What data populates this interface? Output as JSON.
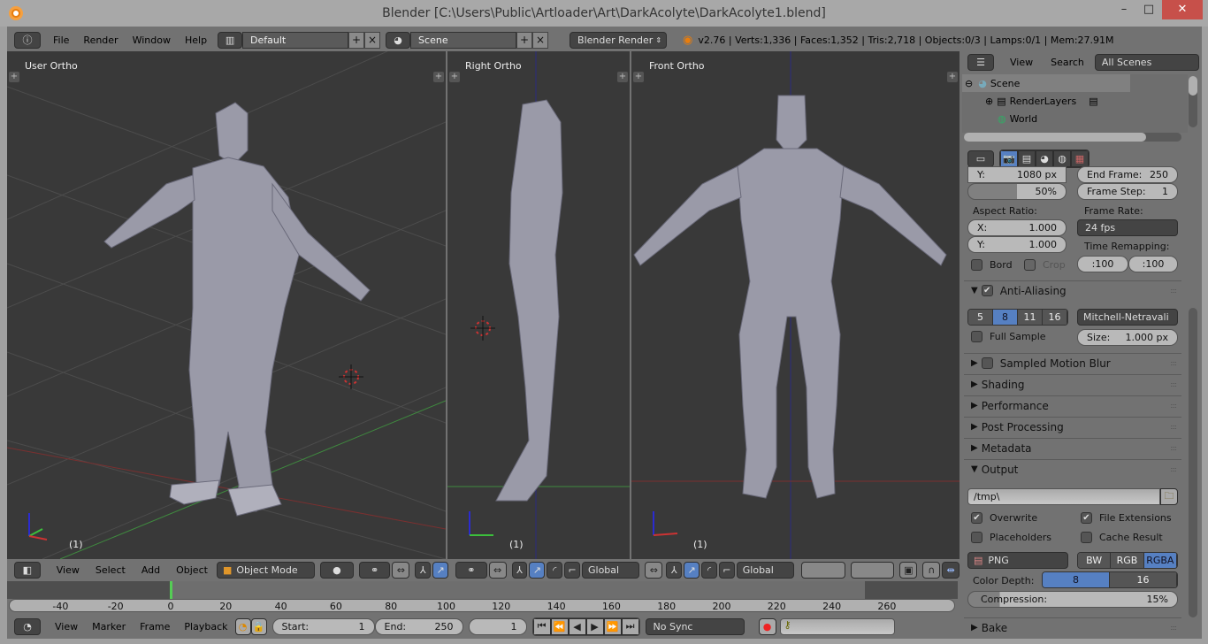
{
  "window": {
    "title": "Blender [C:\\Users\\Public\\Artloader\\Art\\DarkAcolyte\\DarkAcolyte1.blend]",
    "minimize": "–",
    "maximize": "□",
    "close": "✕"
  },
  "topbar": {
    "menus": [
      "File",
      "Render",
      "Window",
      "Help"
    ],
    "layout": "Default",
    "scene": "Scene",
    "engine": "Blender Render",
    "stats": "v2.76 | Verts:1,336 | Faces:1,352 | Tris:2,718 | Objects:0/3 | Lamps:0/1 | Mem:27.91M"
  },
  "viewports": [
    {
      "label": "User Ortho",
      "frame": "(1)"
    },
    {
      "label": "Right Ortho",
      "frame": "(1)"
    },
    {
      "label": "Front Ortho",
      "frame": "(1)"
    }
  ],
  "view3d_header": {
    "menus": [
      "View",
      "Select",
      "Add",
      "Object"
    ],
    "mode": "Object Mode",
    "orientation_1": "Global",
    "orientation_2": "Global"
  },
  "outliner": {
    "view": "View",
    "search": "Search",
    "filter": "All Scenes",
    "items": [
      {
        "label": "Scene",
        "expand": "⊖"
      },
      {
        "label": "RenderLayers",
        "expand": "⊕"
      },
      {
        "label": "World",
        "expand": ""
      }
    ]
  },
  "properties": {
    "res_y": {
      "label": "Y:",
      "value": "1080 px"
    },
    "res_pct": "50%",
    "res_pct_fraction": 0.5,
    "end_frame": {
      "label": "End Frame:",
      "value": "250"
    },
    "frame_step": {
      "label": "Frame Step:",
      "value": "1"
    },
    "aspect_label": "Aspect Ratio:",
    "aspect_x": {
      "label": "X:",
      "value": "1.000"
    },
    "aspect_y": {
      "label": "Y:",
      "value": "1.000"
    },
    "frame_rate_label": "Frame Rate:",
    "frame_rate": "24 fps",
    "time_remap_label": "Time Remapping:",
    "time_old": ":100",
    "time_new": ":100",
    "bord": "Bord",
    "crop": "Crop",
    "aa": {
      "title": "Anti-Aliasing",
      "samples": [
        "5",
        "8",
        "11",
        "16"
      ],
      "selected": "8",
      "filter": "Mitchell-Netravali",
      "full_sample": "Full Sample",
      "size": {
        "label": "Size:",
        "value": "1.000 px"
      }
    },
    "panels": [
      "Sampled Motion Blur",
      "Shading",
      "Performance",
      "Post Processing",
      "Metadata"
    ],
    "output": {
      "title": "Output",
      "path": "/tmp\\",
      "overwrite": "Overwrite",
      "file_extensions": "File Extensions",
      "placeholders": "Placeholders",
      "cache_result": "Cache Result",
      "format": "PNG",
      "color_modes": [
        "BW",
        "RGB",
        "RGBA"
      ],
      "color_mode_selected": "RGBA",
      "color_depth_label": "Color Depth:",
      "depths": [
        "8",
        "16"
      ],
      "depth_selected": "8",
      "compression": {
        "label": "Compression:",
        "value": "15%",
        "fraction": 0.15
      }
    },
    "bake": "Bake"
  },
  "timeline": {
    "ticks": [
      "-40",
      "-20",
      "0",
      "20",
      "40",
      "60",
      "80",
      "100",
      "120",
      "140",
      "160",
      "180",
      "200",
      "220",
      "240",
      "260"
    ],
    "menus": [
      "View",
      "Marker",
      "Frame",
      "Playback"
    ],
    "start": {
      "label": "Start:",
      "value": "1"
    },
    "end": {
      "label": "End:",
      "value": "250"
    },
    "current": "1",
    "sync": "No Sync"
  },
  "colors": {
    "accent": "#5680c2",
    "viewport_bg": "#393939",
    "panel_bg": "#727272",
    "close_red": "#c7504a"
  }
}
